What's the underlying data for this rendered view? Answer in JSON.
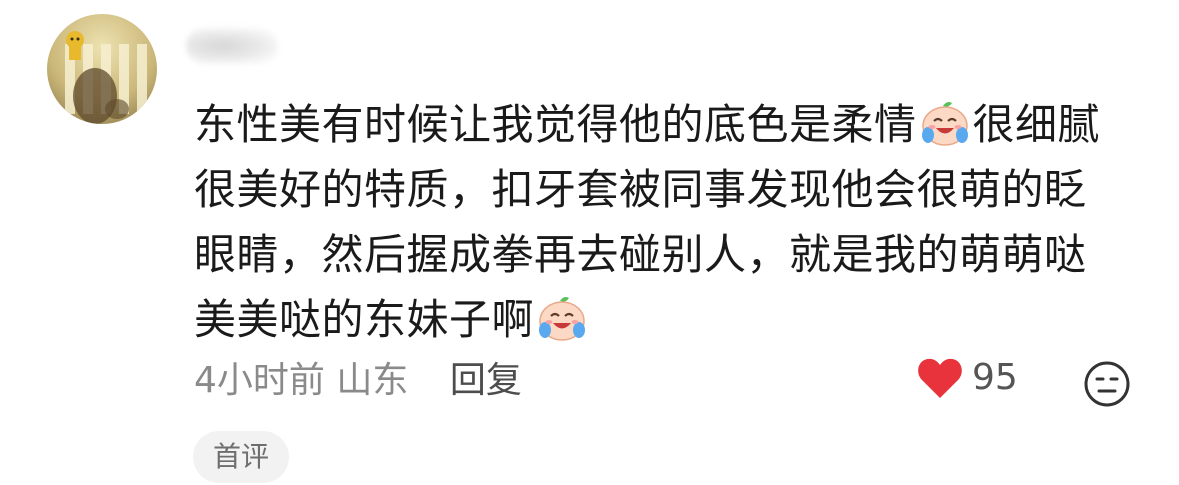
{
  "comment": {
    "lines": [
      "东性美有时候让我觉得他的底色是柔情",
      "很细腻",
      "很美好的特质，扣牙套被同事发现他会很萌的眨",
      "眼睛，然后握成拳再去碰别人，就是我的萌萌哒",
      "美美哒的东妹子啊"
    ],
    "emoji_icon": "crying-laughing-face-icon"
  },
  "meta": {
    "time": "4小时前",
    "location": "山东",
    "reply_label": "回复"
  },
  "likes": {
    "count": "95",
    "color": "#e8323c"
  },
  "tag": {
    "label": "首评"
  }
}
